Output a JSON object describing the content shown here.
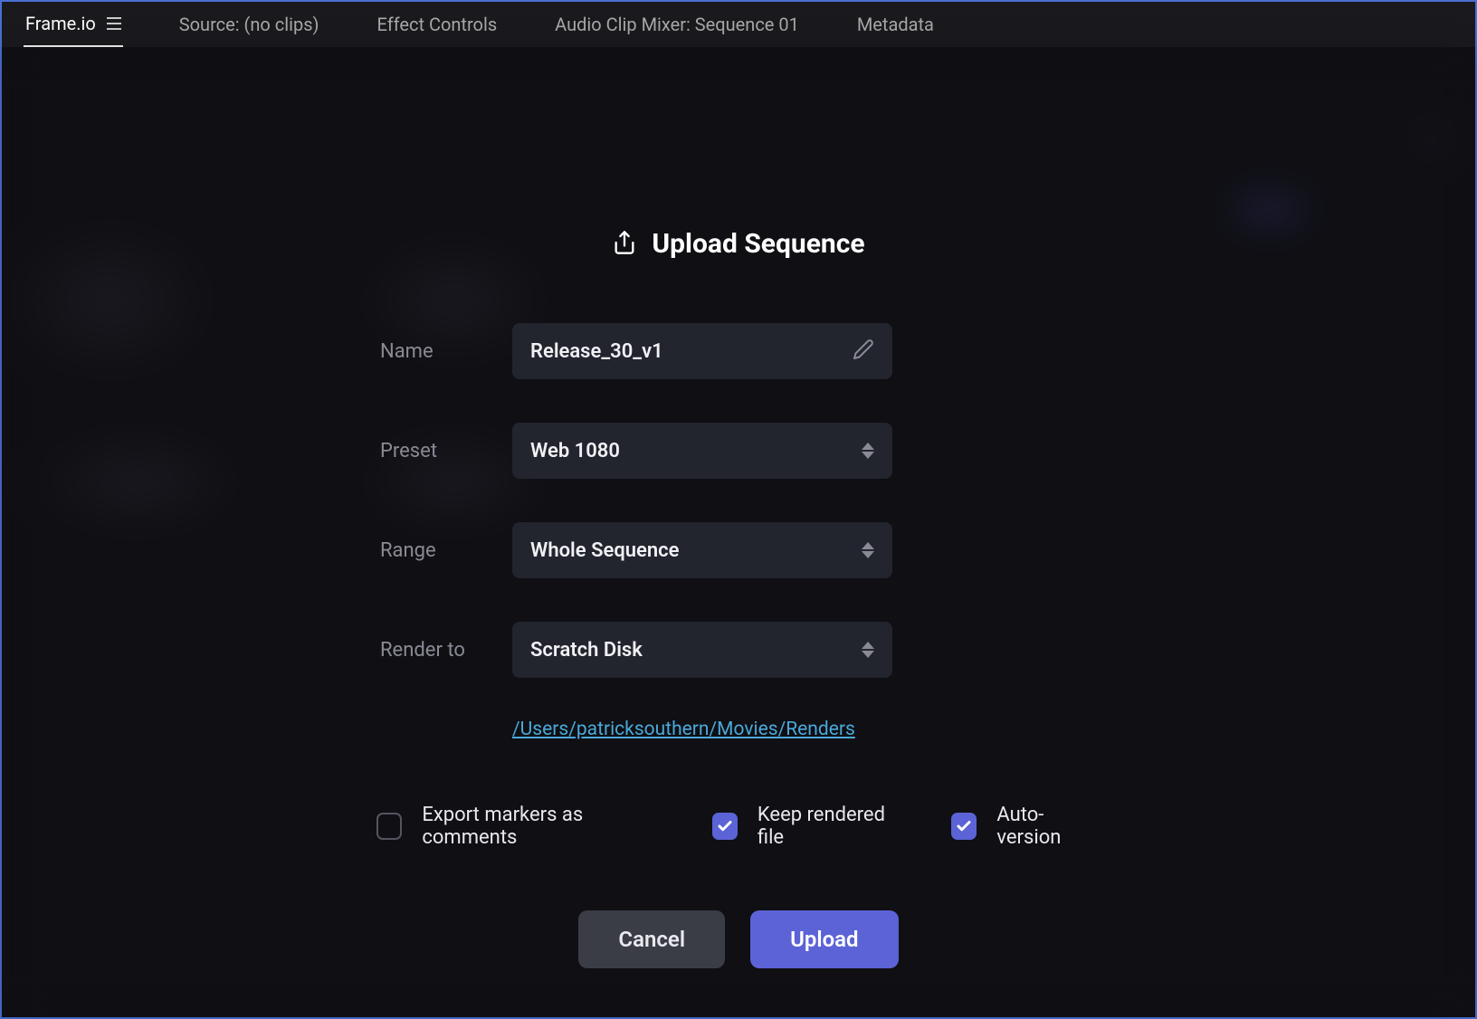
{
  "tabs": {
    "frameio": "Frame.io",
    "source": "Source: (no clips)",
    "effectControls": "Effect Controls",
    "audioMixer": "Audio Clip Mixer: Sequence 01",
    "metadata": "Metadata"
  },
  "dialog": {
    "title": "Upload Sequence",
    "fields": {
      "nameLabel": "Name",
      "nameValue": "Release_30_v1",
      "presetLabel": "Preset",
      "presetValue": "Web 1080",
      "rangeLabel": "Range",
      "rangeValue": "Whole Sequence",
      "renderToLabel": "Render to",
      "renderToValue": "Scratch Disk",
      "renderPath": "/Users/patricksouthern/Movies/Renders"
    },
    "checkboxes": {
      "exportMarkers": "Export markers as comments",
      "keepRendered": "Keep rendered file",
      "autoVersion": "Auto-version"
    },
    "buttons": {
      "cancel": "Cancel",
      "upload": "Upload"
    }
  }
}
